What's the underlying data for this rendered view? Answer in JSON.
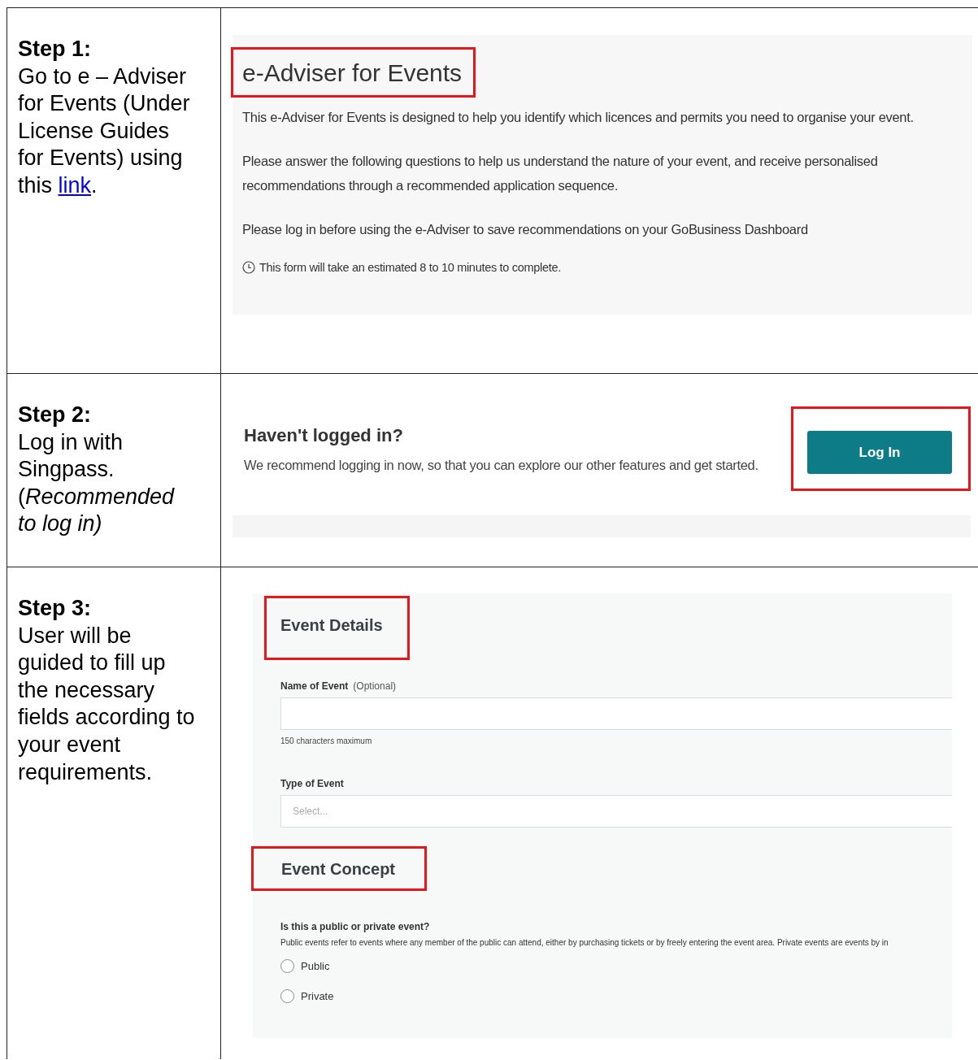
{
  "rows": [
    {
      "kind": "intro",
      "label": "Step 1:",
      "text": "Go to e – Adviser for Events (Under License Guides for Events) using this ",
      "link": "link",
      "after": "."
    },
    {
      "kind": "login",
      "label": "Step 2:",
      "text": "Log in with Singpass. (*Recommended to log in)*"
    },
    {
      "kind": "form",
      "label": "Step 3:",
      "text": "User will be guided to fill up the necessary fields according to your event requirements."
    }
  ],
  "adviser_intro": {
    "title": "e-Adviser for Events",
    "title_highlighted": true,
    "paragraphs": [
      "This e-Adviser for Events is designed to help you identify which licences and permits you need to organise your event.",
      "Please answer the following questions to help us understand the nature of your event, and receive personalised recommendations through a recommended application sequence.",
      "Please log in before using the e-Adviser to save recommendations on your GoBusiness Dashboard"
    ],
    "duration_note": "This form will take an estimated 8 to 10 minutes to complete."
  },
  "login_prompt": {
    "heading": "Haven't logged in?",
    "text": "We recommend logging in now, so that you can explore our other features and get started.",
    "button": "Log In",
    "button_highlighted": true
  },
  "event_form": {
    "details_heading": "Event Details",
    "details_highlighted": true,
    "name_label": "Name of Event",
    "name_optional": "(Optional)",
    "name_hint": "150 characters maximum",
    "type_label": "Type of Event",
    "type_placeholder": "Select...",
    "concept_heading": "Event Concept",
    "concept_highlighted": true,
    "question": "Is this a public or private event?",
    "question_help": "Public events refer to events where any member of the public can attend, either by purchasing tickets or by freely entering the event area. Private events are events by in",
    "options": [
      {
        "label": "Public",
        "selected": false
      },
      {
        "label": "Private",
        "selected": false
      }
    ]
  }
}
